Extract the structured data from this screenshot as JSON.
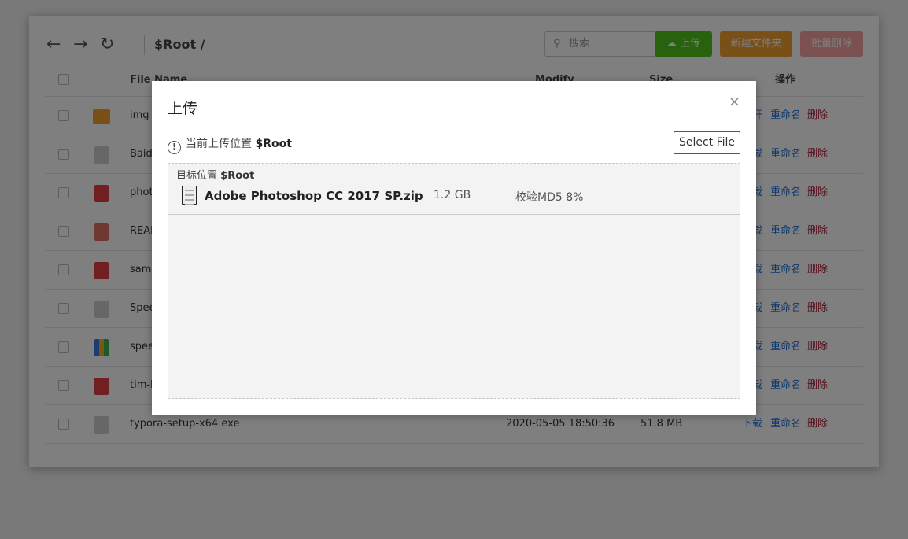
{
  "toolbar": {
    "back_icon": "arrow-left",
    "forward_icon": "arrow-right",
    "refresh_icon": "refresh",
    "breadcrumb": "$Root /",
    "search_placeholder": "搜索",
    "upload": "上传",
    "new_folder": "新建文件夹",
    "batch_delete": "批量删除"
  },
  "colors": {
    "upload": "#52c41a",
    "new_folder": "#f0a030",
    "batch_delete": "#f5a0a0",
    "link": "#1e6fd9",
    "danger": "#b0203a"
  },
  "table": {
    "headers": {
      "name": "File Name",
      "modify": "Modify",
      "size": "Size",
      "actions": "操作"
    },
    "rows": [
      {
        "name": "img",
        "icon": "folder",
        "modify": "",
        "size": "",
        "actions": [
          "打开",
          "重命名",
          "删除"
        ]
      },
      {
        "name": "Baidu",
        "icon": "file",
        "modify": "",
        "size": "",
        "actions": [
          "下载",
          "重命名",
          "删除"
        ]
      },
      {
        "name": "phot",
        "icon": "image",
        "modify": "",
        "size": "",
        "actions": [
          "下载",
          "重命名",
          "删除"
        ]
      },
      {
        "name": "READ",
        "icon": "code",
        "modify": "",
        "size": "",
        "actions": [
          "下载",
          "重命名",
          "删除"
        ]
      },
      {
        "name": "samu",
        "icon": "image",
        "modify": "",
        "size": "",
        "actions": [
          "下载",
          "重命名",
          "删除"
        ]
      },
      {
        "name": "Spee",
        "icon": "file",
        "modify": "",
        "size": "",
        "actions": [
          "下载",
          "重命名",
          "删除"
        ]
      },
      {
        "name": "spee",
        "icon": "zip",
        "modify": "",
        "size": "",
        "actions": [
          "下载",
          "重命名",
          "删除"
        ]
      },
      {
        "name": "tim-b",
        "icon": "image",
        "modify": "",
        "size": "",
        "actions": [
          "下载",
          "重命名",
          "删除"
        ]
      },
      {
        "name": "typora-setup-x64.exe",
        "icon": "file",
        "modify": "2020-05-05 18:50:36",
        "size": "51.8 MB",
        "actions": [
          "下载",
          "重命名",
          "删除"
        ]
      }
    ]
  },
  "modal": {
    "title": "上传",
    "close": "×",
    "location_label": "当前上传位置",
    "location": "$Root",
    "select_file": "Select File",
    "target_label": "目标位置",
    "target": "$Root",
    "file": {
      "name": "Adobe Photoshop CC 2017 SP.zip",
      "size": "1.2 GB",
      "status": "校验MD5 8%"
    }
  }
}
